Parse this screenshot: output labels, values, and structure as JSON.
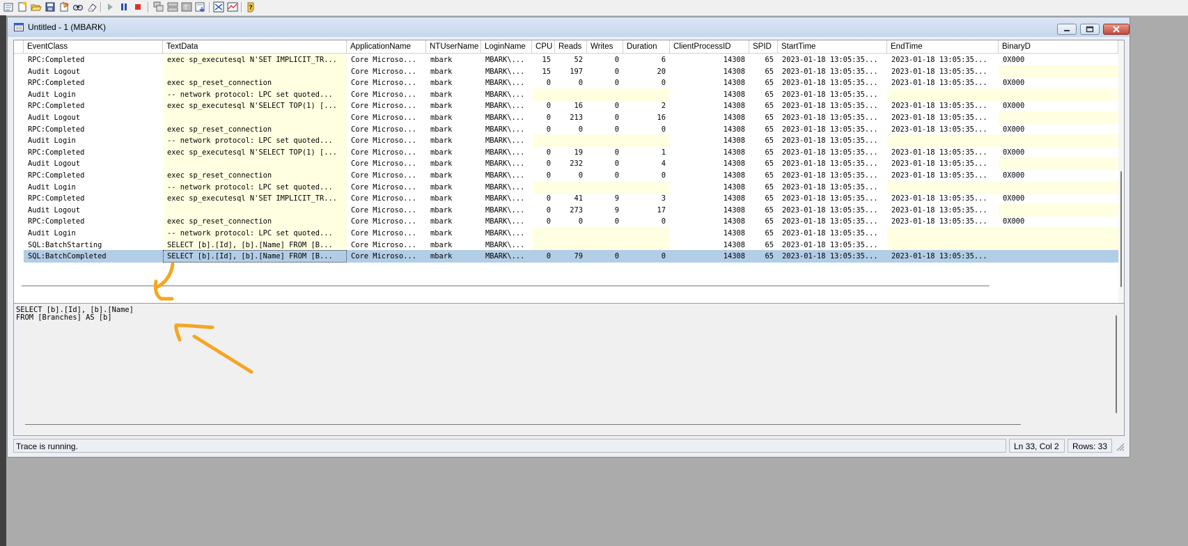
{
  "toolbar": {
    "buttons": [
      {
        "name": "properties-icon"
      },
      {
        "name": "new-trace-icon"
      },
      {
        "name": "open-icon"
      },
      {
        "name": "save-icon"
      },
      {
        "name": "template-icon"
      },
      {
        "name": "find-icon"
      },
      {
        "name": "clear-trace-icon"
      },
      {
        "name": "run-trace-icon"
      },
      {
        "name": "pause-trace-icon"
      },
      {
        "name": "stop-trace-icon"
      },
      {
        "name": "cascade-icon"
      },
      {
        "name": "tile-icon"
      },
      {
        "name": "column-icon"
      },
      {
        "name": "autoscroll-icon"
      },
      {
        "name": "activity-monitor-icon"
      },
      {
        "name": "performance-monitor-icon"
      },
      {
        "name": "help-icon"
      }
    ]
  },
  "window": {
    "title": "Untitled - 1 (MBARK)",
    "accent_color": "#c6d7ec"
  },
  "grid": {
    "columns": [
      "EventClass",
      "TextData",
      "ApplicationName",
      "NTUserName",
      "LoginName",
      "CPU",
      "Reads",
      "Writes",
      "Duration",
      "ClientProcessID",
      "SPID",
      "StartTime",
      "EndTime",
      "BinaryD"
    ],
    "rows": [
      [
        "RPC:Completed",
        "exec sp_executesql N'SET IMPLICIT_TR...",
        "Core Microso...",
        "mbark",
        "MBARK\\...",
        "15",
        "52",
        "0",
        "6",
        "14308",
        "65",
        "2023-01-18 13:05:35...",
        "2023-01-18 13:05:35...",
        "0X000"
      ],
      [
        "Audit Logout",
        "",
        "Core Microso...",
        "mbark",
        "MBARK\\...",
        "15",
        "197",
        "0",
        "20",
        "14308",
        "65",
        "2023-01-18 13:05:35...",
        "2023-01-18 13:05:35...",
        ""
      ],
      [
        "RPC:Completed",
        "exec sp_reset_connection",
        "Core Microso...",
        "mbark",
        "MBARK\\...",
        "0",
        "0",
        "0",
        "0",
        "14308",
        "65",
        "2023-01-18 13:05:35...",
        "2023-01-18 13:05:35...",
        "0X000"
      ],
      [
        "Audit Login",
        "-- network protocol: LPC  set quoted...",
        "Core Microso...",
        "mbark",
        "MBARK\\...",
        "",
        "",
        "",
        "",
        "14308",
        "65",
        "2023-01-18 13:05:35...",
        "",
        ""
      ],
      [
        "RPC:Completed",
        "exec sp_executesql N'SELECT TOP(1) [...",
        "Core Microso...",
        "mbark",
        "MBARK\\...",
        "0",
        "16",
        "0",
        "2",
        "14308",
        "65",
        "2023-01-18 13:05:35...",
        "2023-01-18 13:05:35...",
        "0X000"
      ],
      [
        "Audit Logout",
        "",
        "Core Microso...",
        "mbark",
        "MBARK\\...",
        "0",
        "213",
        "0",
        "16",
        "14308",
        "65",
        "2023-01-18 13:05:35...",
        "2023-01-18 13:05:35...",
        ""
      ],
      [
        "RPC:Completed",
        "exec sp_reset_connection",
        "Core Microso...",
        "mbark",
        "MBARK\\...",
        "0",
        "0",
        "0",
        "0",
        "14308",
        "65",
        "2023-01-18 13:05:35...",
        "2023-01-18 13:05:35...",
        "0X000"
      ],
      [
        "Audit Login",
        "-- network protocol: LPC  set quoted...",
        "Core Microso...",
        "mbark",
        "MBARK\\...",
        "",
        "",
        "",
        "",
        "14308",
        "65",
        "2023-01-18 13:05:35...",
        "",
        ""
      ],
      [
        "RPC:Completed",
        "exec sp_executesql N'SELECT TOP(1) [...",
        "Core Microso...",
        "mbark",
        "MBARK\\...",
        "0",
        "19",
        "0",
        "1",
        "14308",
        "65",
        "2023-01-18 13:05:35...",
        "2023-01-18 13:05:35...",
        "0X000"
      ],
      [
        "Audit Logout",
        "",
        "Core Microso...",
        "mbark",
        "MBARK\\...",
        "0",
        "232",
        "0",
        "4",
        "14308",
        "65",
        "2023-01-18 13:05:35...",
        "2023-01-18 13:05:35...",
        ""
      ],
      [
        "RPC:Completed",
        "exec sp_reset_connection",
        "Core Microso...",
        "mbark",
        "MBARK\\...",
        "0",
        "0",
        "0",
        "0",
        "14308",
        "65",
        "2023-01-18 13:05:35...",
        "2023-01-18 13:05:35...",
        "0X000"
      ],
      [
        "Audit Login",
        "-- network protocol: LPC  set quoted...",
        "Core Microso...",
        "mbark",
        "MBARK\\...",
        "",
        "",
        "",
        "",
        "14308",
        "65",
        "2023-01-18 13:05:35...",
        "",
        ""
      ],
      [
        "RPC:Completed",
        "exec sp_executesql N'SET IMPLICIT_TR...",
        "Core Microso...",
        "mbark",
        "MBARK\\...",
        "0",
        "41",
        "9",
        "3",
        "14308",
        "65",
        "2023-01-18 13:05:35...",
        "2023-01-18 13:05:35...",
        "0X000"
      ],
      [
        "Audit Logout",
        "",
        "Core Microso...",
        "mbark",
        "MBARK\\...",
        "0",
        "273",
        "9",
        "17",
        "14308",
        "65",
        "2023-01-18 13:05:35...",
        "2023-01-18 13:05:35...",
        ""
      ],
      [
        "RPC:Completed",
        "exec sp_reset_connection",
        "Core Microso...",
        "mbark",
        "MBARK\\...",
        "0",
        "0",
        "0",
        "0",
        "14308",
        "65",
        "2023-01-18 13:05:35...",
        "2023-01-18 13:05:35...",
        "0X000"
      ],
      [
        "Audit Login",
        "-- network protocol: LPC  set quoted...",
        "Core Microso...",
        "mbark",
        "MBARK\\...",
        "",
        "",
        "",
        "",
        "14308",
        "65",
        "2023-01-18 13:05:35...",
        "",
        ""
      ],
      [
        "SQL:BatchStarting",
        "SELECT [b].[Id], [b].[Name]  FROM [B...",
        "Core Microso...",
        "mbark",
        "MBARK\\...",
        "",
        "",
        "",
        "",
        "14308",
        "65",
        "2023-01-18 13:05:35...",
        "",
        ""
      ],
      [
        "SQL:BatchCompleted",
        "SELECT [b].[Id], [b].[Name]  FROM [B...",
        "Core Microso...",
        "mbark",
        "MBARK\\...",
        "0",
        "79",
        "0",
        "0",
        "14308",
        "65",
        "2023-01-18 13:05:35...",
        "2023-01-18 13:05:35...",
        ""
      ]
    ],
    "selected_row": 17,
    "cell_highlight_color": "#ffffe1",
    "selection_color": "#b2cde6"
  },
  "text_pane": {
    "content": "SELECT [b].[Id], [b].[Name]\nFROM [Branches] AS [b]"
  },
  "status": {
    "message": "Trace is running.",
    "position": "Ln 33, Col 2",
    "rows": "Rows: 33"
  },
  "annotation_color": "#f5a623"
}
